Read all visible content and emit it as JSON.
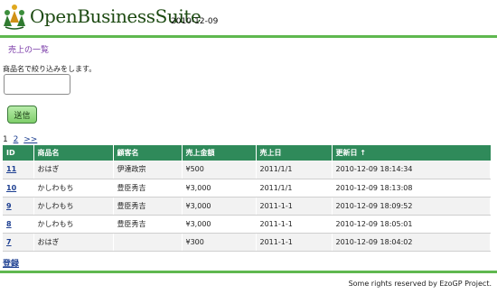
{
  "header": {
    "logo_text": "OpenBusinessSuite",
    "date": "2010-12-09"
  },
  "page_link": "売上の一覧",
  "filter": {
    "label": "商品名で絞り込みをします。",
    "value": "",
    "submit_label": "送信"
  },
  "pager": {
    "page1": "1",
    "page2": "2",
    "next": ">>"
  },
  "table": {
    "headers": [
      "ID",
      "商品名",
      "顧客名",
      "売上金額",
      "売上日",
      "更新日 ↑"
    ],
    "rows": [
      {
        "id": "11",
        "product": "おはぎ",
        "customer": "伊達政宗",
        "amount": "¥500",
        "sale_date": "2011/1/1",
        "updated": "2010-12-09 18:14:34"
      },
      {
        "id": "10",
        "product": "かしわもち",
        "customer": "豊臣秀吉",
        "amount": "¥3,000",
        "sale_date": "2011/1/1",
        "updated": "2010-12-09 18:13:08"
      },
      {
        "id": "9",
        "product": "かしわもち",
        "customer": "豊臣秀吉",
        "amount": "¥3,000",
        "sale_date": "2011-1-1",
        "updated": "2010-12-09 18:09:52"
      },
      {
        "id": "8",
        "product": "かしわもち",
        "customer": "豊臣秀吉",
        "amount": "¥3,000",
        "sale_date": "2011-1-1",
        "updated": "2010-12-09 18:05:01"
      },
      {
        "id": "7",
        "product": "おはぎ",
        "customer": "",
        "amount": "¥300",
        "sale_date": "2011-1-1",
        "updated": "2010-12-09 18:04:02"
      }
    ]
  },
  "register_link": "登録",
  "footer": "Some rights reserved by EzoGP Project.",
  "colors": {
    "accent_green": "#5fb84f",
    "table_header": "#2f8a5a",
    "link": "#1d3f91"
  },
  "icons": {
    "logo": "people-circle-logo-icon"
  }
}
